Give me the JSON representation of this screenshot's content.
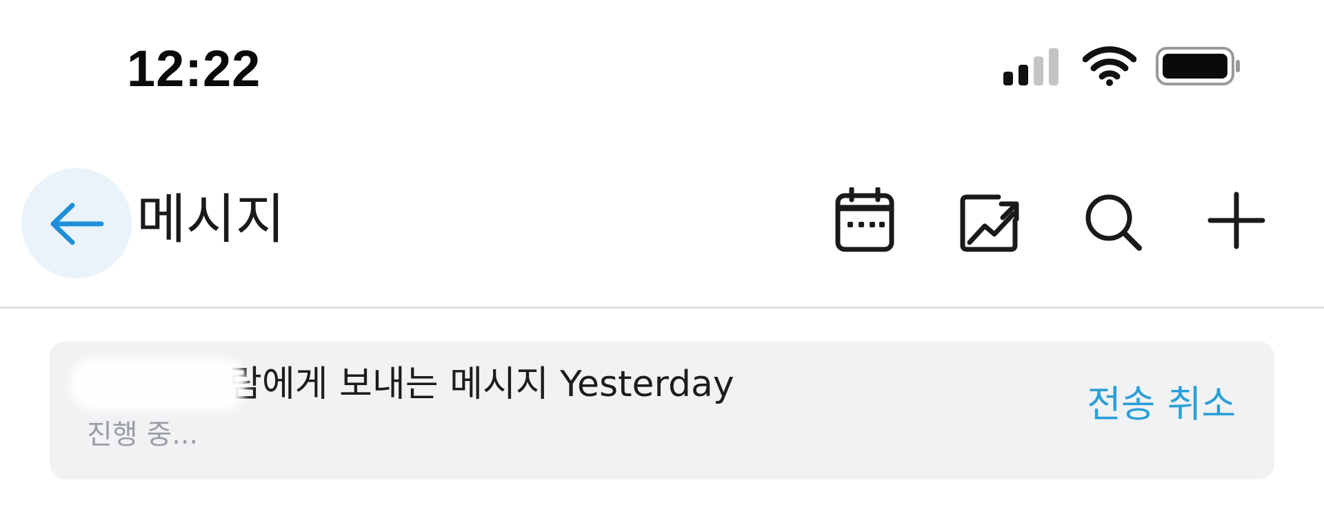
{
  "status_bar": {
    "time": "12:22",
    "icons": [
      "signal-icon",
      "wifi-icon",
      "battery-icon"
    ]
  },
  "header": {
    "back_icon": "arrow-left-icon",
    "title": "메시지",
    "actions": [
      "calendar-icon",
      "trending-up-chart-icon",
      "search-icon",
      "plus-icon"
    ]
  },
  "message_card": {
    "recipient_partial": "람에게 보내는 메시지",
    "time_label": "Yesterday",
    "status": "진행 중...",
    "cancel_label": "전송 취소"
  },
  "colors": {
    "accent": "#2a9fd8",
    "back_button_bg": "#eaf3fa",
    "card_bg": "#f1f2f4",
    "divider": "#dcdde1",
    "muted_text": "#9a9da3"
  }
}
